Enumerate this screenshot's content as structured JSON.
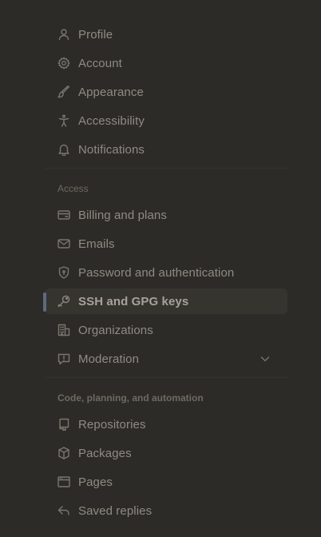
{
  "nav": {
    "personal": [
      {
        "label": "Profile",
        "icon": "person-icon"
      },
      {
        "label": "Account",
        "icon": "gear-icon"
      },
      {
        "label": "Appearance",
        "icon": "paintbrush-icon"
      },
      {
        "label": "Accessibility",
        "icon": "accessibility-icon"
      },
      {
        "label": "Notifications",
        "icon": "bell-icon"
      }
    ],
    "access": {
      "title": "Access",
      "items": [
        {
          "label": "Billing and plans",
          "icon": "credit-card-icon"
        },
        {
          "label": "Emails",
          "icon": "mail-icon"
        },
        {
          "label": "Password and authentication",
          "icon": "shield-lock-icon"
        },
        {
          "label": "SSH and GPG keys",
          "icon": "key-icon",
          "active": true
        },
        {
          "label": "Organizations",
          "icon": "organization-icon"
        },
        {
          "label": "Moderation",
          "icon": "report-icon",
          "expandable": true
        }
      ]
    },
    "code": {
      "title": "Code, planning, and automation",
      "items": [
        {
          "label": "Repositories",
          "icon": "repo-icon"
        },
        {
          "label": "Packages",
          "icon": "package-icon"
        },
        {
          "label": "Pages",
          "icon": "browser-icon"
        },
        {
          "label": "Saved replies",
          "icon": "reply-icon"
        }
      ]
    }
  },
  "colors": {
    "background": "#2d2b27",
    "active_background": "#36342f",
    "active_indicator": "#5d6a80",
    "text": "#8f8b84",
    "section_title": "#6d6963"
  }
}
